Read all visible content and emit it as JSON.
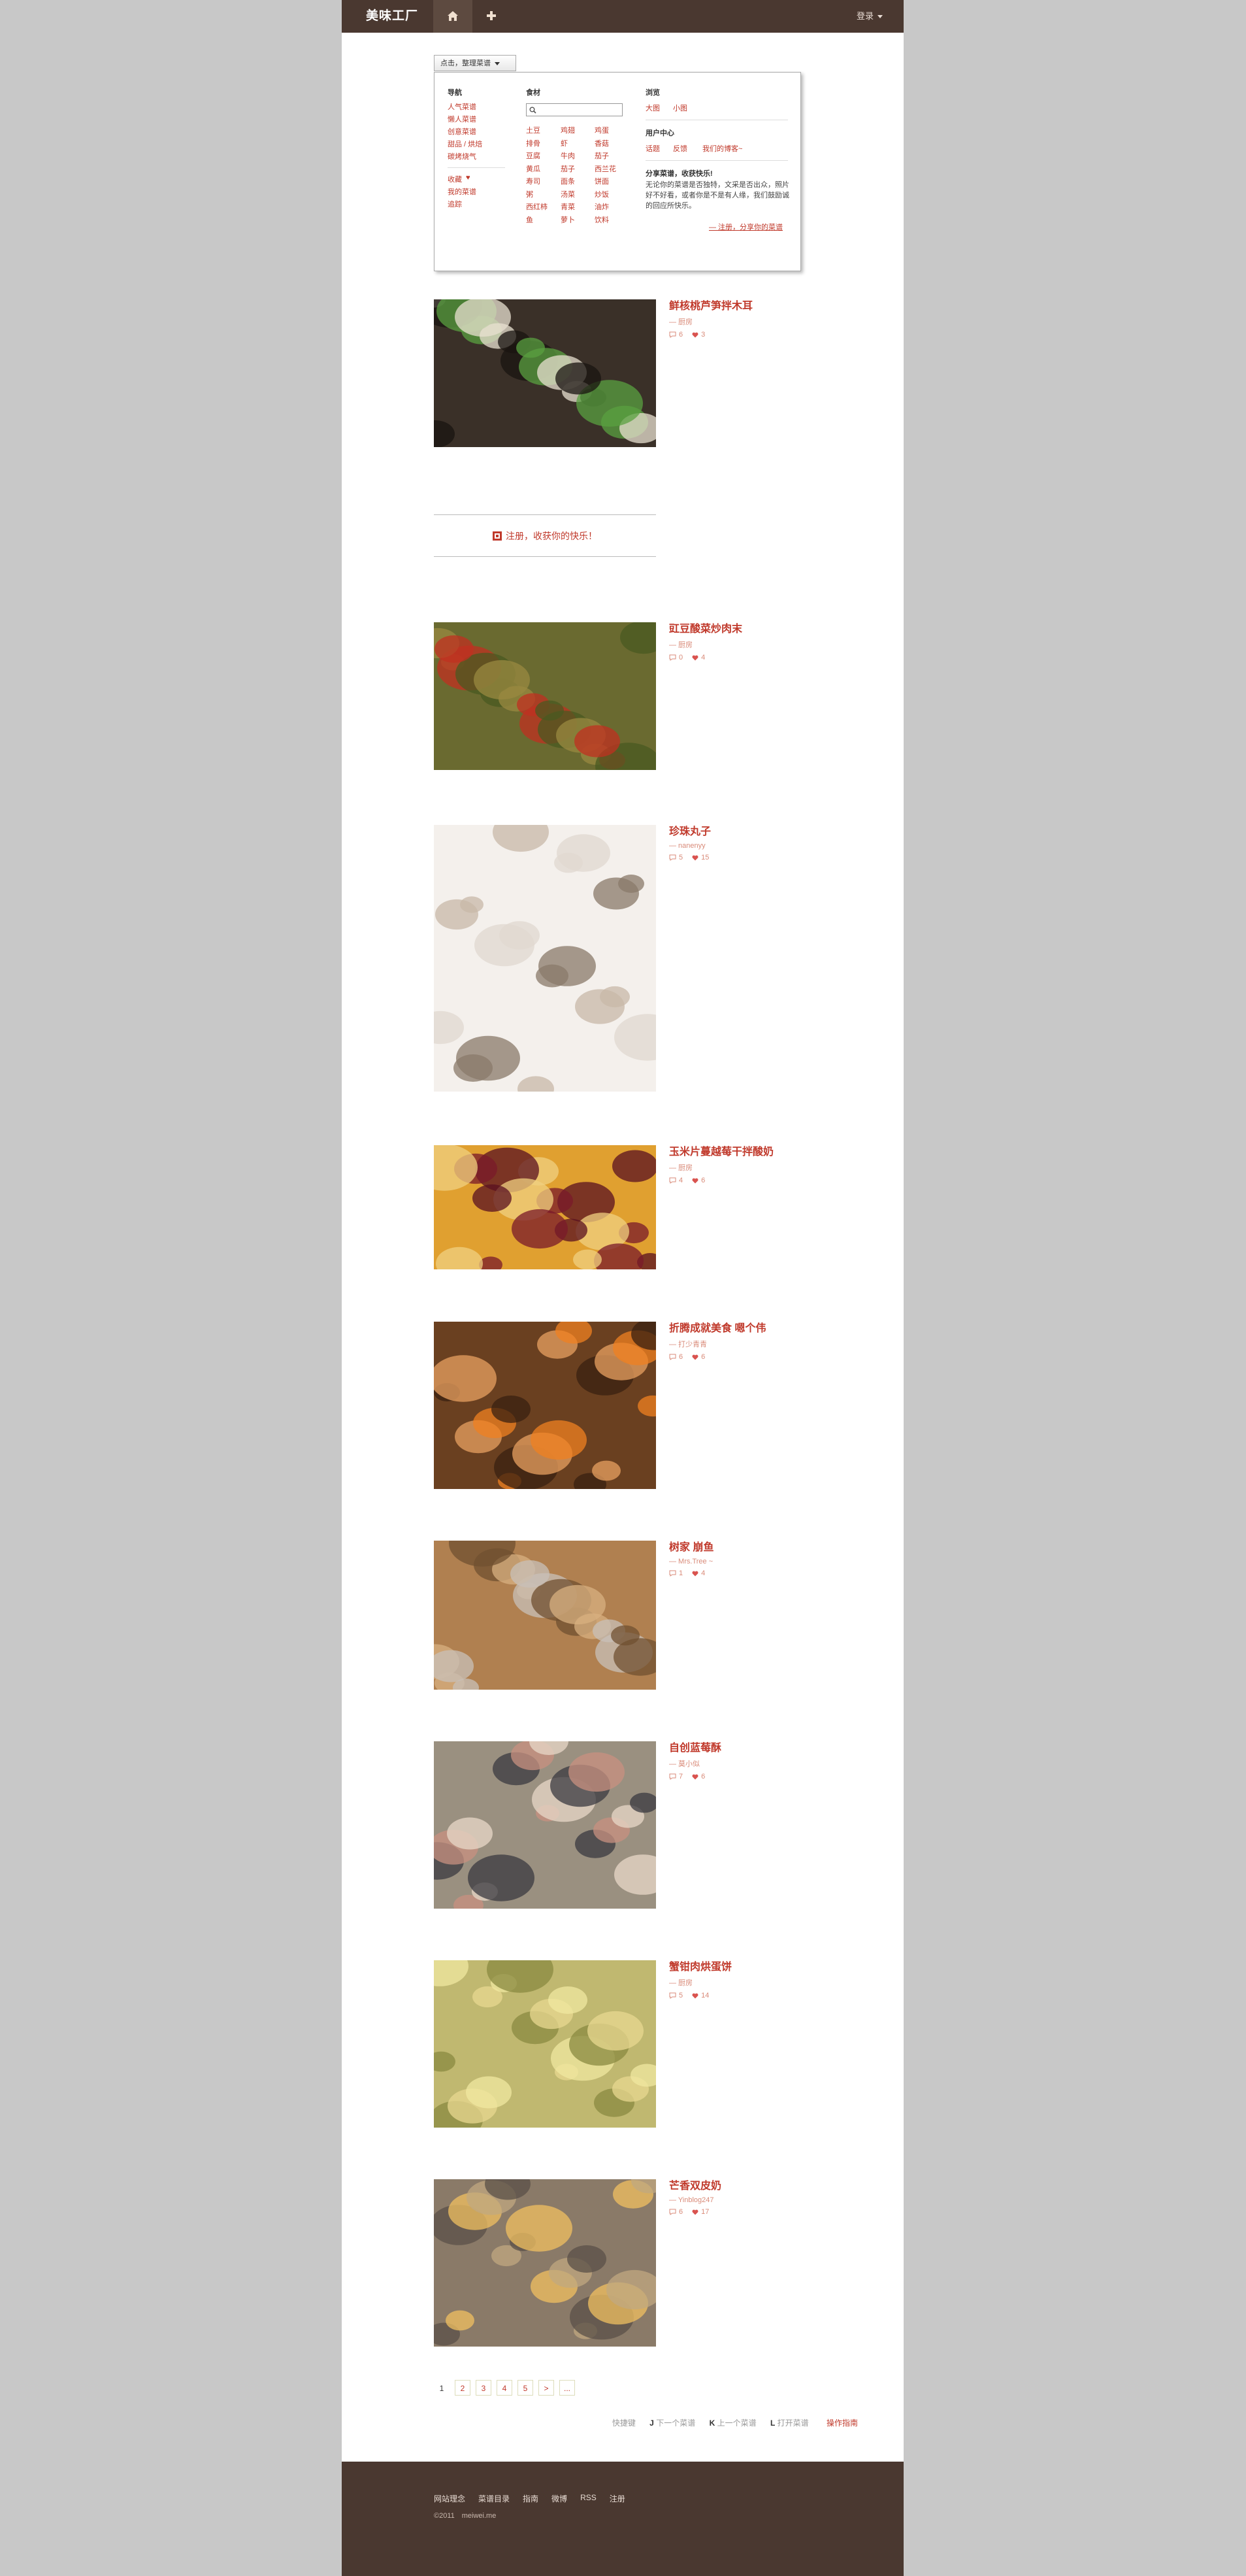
{
  "header": {
    "brand": "美味工厂",
    "login_label": "登录"
  },
  "filter": {
    "button_label": "点击，整理菜谱",
    "nav_heading": "导航",
    "nav_items": [
      "人气菜谱",
      "懒人菜谱",
      "创意菜谱",
      "甜品 / 烘焙",
      "碳烤烧气"
    ],
    "nav_items2": [
      "收藏",
      "我的菜谱",
      "追踪"
    ],
    "ingredients_heading": "食材",
    "ingredients": [
      [
        "土豆",
        "鸡翅",
        "鸡蛋"
      ],
      [
        "排骨",
        "虾",
        "香菇"
      ],
      [
        "豆腐",
        "牛肉",
        "茄子"
      ],
      [
        "黄瓜",
        "茄子",
        "西兰花"
      ],
      [
        "寿司",
        "面条",
        "饼面"
      ],
      [
        "粥",
        "汤菜",
        "炒饭"
      ],
      [
        "西红柿",
        "青菜",
        "油炸"
      ],
      [
        "鱼",
        "萝卜",
        "饮料"
      ]
    ],
    "size_heading": "浏览",
    "size_options": [
      "大图",
      "小图"
    ],
    "user_heading": "用户中心",
    "user_links": [
      "话题",
      "反馈",
      "我们的博客~"
    ],
    "share_heading": "分享菜谱，收获快乐!",
    "share_text": "无论你的菜谱是否独特，文采是否出众，照片好不好看，或者你是不是有人缘，我们鼓励诚的回应所快乐。",
    "share_link": "— 注册，分享你的菜谱"
  },
  "recipes": [
    {
      "title": "鲜核桃芦笋拌木耳",
      "author": "— 厨房",
      "comments": "6",
      "likes": "3"
    },
    {
      "title": "豇豆酸菜炒肉末",
      "author": "— 厨房",
      "comments": "0",
      "likes": "4"
    },
    {
      "title": "珍珠丸子",
      "author": "— nanenyy",
      "comments": "5",
      "likes": "15"
    },
    {
      "title": "玉米片蔓越莓干拌酸奶",
      "author": "— 厨房",
      "comments": "4",
      "likes": "6"
    },
    {
      "title": "折腾成就美食 嗯个伟",
      "author": "— 打少青青",
      "comments": "6",
      "likes": "6"
    },
    {
      "title": "树家 崩鱼",
      "author": "— Mrs.Tree ~",
      "comments": "1",
      "likes": "4"
    },
    {
      "title": "自创蓝莓酥",
      "author": "— 莫小似",
      "comments": "7",
      "likes": "6"
    },
    {
      "title": "蟹钳肉烘蛋饼",
      "author": "— 厨房",
      "comments": "5",
      "likes": "14"
    },
    {
      "title": "芒香双皮奶",
      "author": "— Yinblog247",
      "comments": "6",
      "likes": "17"
    }
  ],
  "promo": {
    "text": "注册，收获你的快乐！"
  },
  "pagination": [
    "1",
    "2",
    "3",
    "4",
    "5",
    ">",
    "..."
  ],
  "shortcuts": {
    "label": "快捷键",
    "j_key": "J",
    "j_label": "下一个菜谱",
    "k_key": "K",
    "k_label": "上一个菜谱",
    "l_key": "L",
    "l_label": "打开菜谱",
    "guide": "操作指南"
  },
  "footer": {
    "links": [
      "网站理念",
      "菜谱目录",
      "指南",
      "微博",
      "RSS",
      "注册"
    ],
    "copyright": "©2011　meiwei.me"
  }
}
